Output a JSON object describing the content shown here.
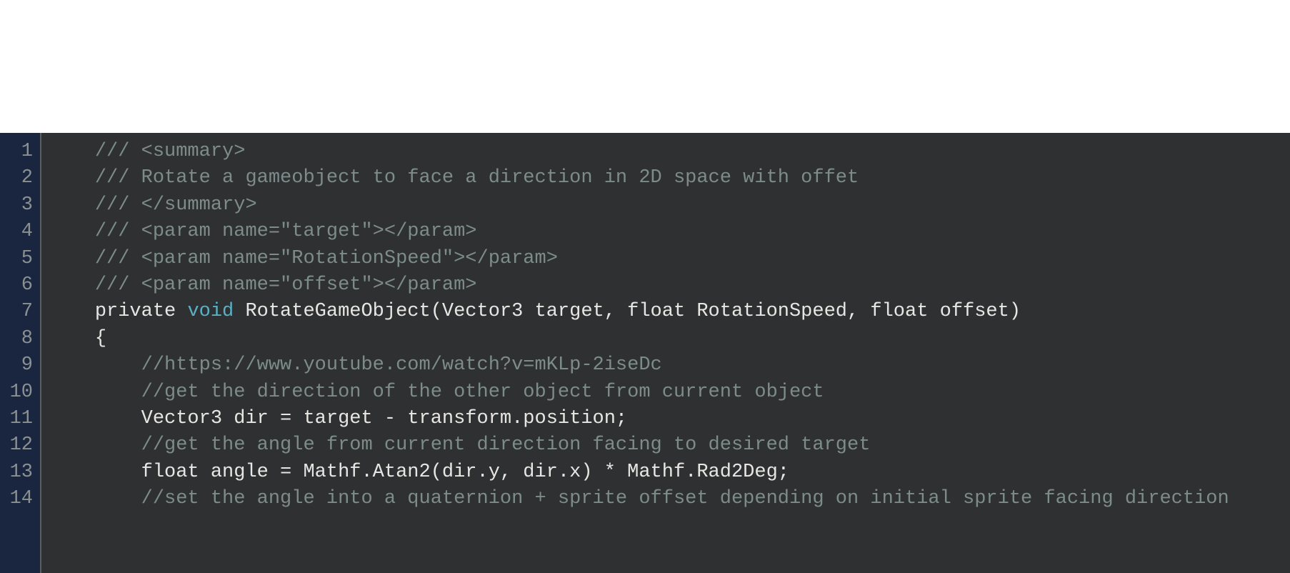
{
  "editor": {
    "language": "csharp",
    "lineStart": 1,
    "lines": [
      {
        "number": 1,
        "indent": "    ",
        "tokens": [
          {
            "type": "comment",
            "text": "/// <summary>"
          }
        ]
      },
      {
        "number": 2,
        "indent": "    ",
        "tokens": [
          {
            "type": "comment",
            "text": "/// Rotate a gameobject to face a direction in 2D space with offet"
          }
        ]
      },
      {
        "number": 3,
        "indent": "    ",
        "tokens": [
          {
            "type": "comment",
            "text": "/// </summary>"
          }
        ]
      },
      {
        "number": 4,
        "indent": "    ",
        "tokens": [
          {
            "type": "comment",
            "text": "/// <param name=\"target\"></param>"
          }
        ]
      },
      {
        "number": 5,
        "indent": "    ",
        "tokens": [
          {
            "type": "comment",
            "text": "/// <param name=\"RotationSpeed\"></param>"
          }
        ]
      },
      {
        "number": 6,
        "indent": "    ",
        "tokens": [
          {
            "type": "comment",
            "text": "/// <param name=\"offset\"></param>"
          }
        ]
      },
      {
        "number": 7,
        "indent": "    ",
        "tokens": [
          {
            "type": "normal",
            "text": "private "
          },
          {
            "type": "keyword",
            "text": "void"
          },
          {
            "type": "normal",
            "text": " RotateGameObject(Vector3 target, float RotationSpeed, float offset)"
          }
        ]
      },
      {
        "number": 8,
        "indent": "    ",
        "tokens": [
          {
            "type": "normal",
            "text": "{"
          }
        ]
      },
      {
        "number": 9,
        "indent": "        ",
        "tokens": [
          {
            "type": "comment",
            "text": "//https://www.youtube.com/watch?v=mKLp-2iseDc"
          }
        ]
      },
      {
        "number": 10,
        "indent": "        ",
        "tokens": [
          {
            "type": "comment",
            "text": "//get the direction of the other object from current object"
          }
        ]
      },
      {
        "number": 11,
        "indent": "        ",
        "tokens": [
          {
            "type": "normal",
            "text": "Vector3 dir = target - transform.position;"
          }
        ]
      },
      {
        "number": 12,
        "indent": "        ",
        "tokens": [
          {
            "type": "comment",
            "text": "//get the angle from current direction facing to desired target"
          }
        ]
      },
      {
        "number": 13,
        "indent": "        ",
        "tokens": [
          {
            "type": "normal",
            "text": "float angle = Mathf.Atan2(dir.y, dir.x) * Mathf.Rad2Deg;"
          }
        ]
      },
      {
        "number": 14,
        "indent": "        ",
        "tokens": [
          {
            "type": "comment",
            "text": "//set the angle into a quaternion + sprite offset depending on initial sprite facing direction"
          }
        ]
      }
    ]
  }
}
